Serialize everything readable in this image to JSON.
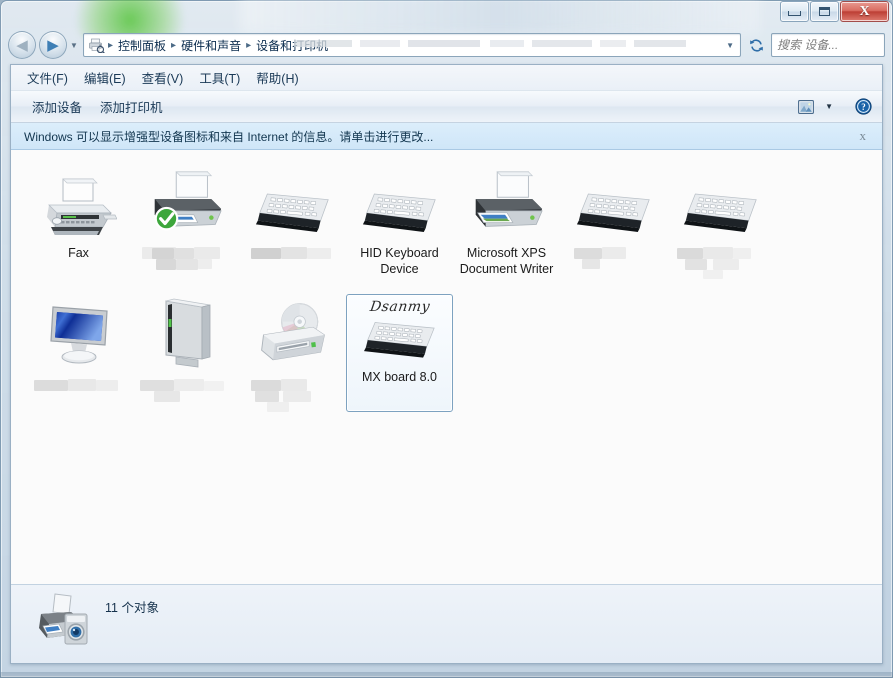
{
  "window": {
    "title": "设备和打印机",
    "buttons": {
      "minimize": "minimize-button",
      "maximize": "maximize-button",
      "close_glyph": "X"
    }
  },
  "navbar": {
    "back_tooltip": "后退",
    "forward_tooltip": "前进",
    "breadcrumb": [
      "控制面板",
      "硬件和声音",
      "设备和打印机"
    ],
    "breadcrumb_separator": "▶",
    "dropdown_glyph": "▼",
    "refresh_glyph": "↻",
    "search": {
      "placeholder": "搜索 设备...",
      "value": ""
    }
  },
  "menu": {
    "items": [
      "文件(F)",
      "编辑(E)",
      "查看(V)",
      "工具(T)",
      "帮助(H)"
    ]
  },
  "commandbar": {
    "items": [
      "添加设备",
      "添加打印机"
    ],
    "view_caret": "▼",
    "help_glyph": "?"
  },
  "notification": {
    "message": "Windows 可以显示增强型设备图标和来自 Internet 的信息。请单击进行更改...",
    "close_glyph": "x"
  },
  "devices": [
    {
      "label": "Fax",
      "icon": "fax-icon",
      "redacted": false,
      "selected": false,
      "default": false
    },
    {
      "label": "",
      "icon": "printer-icon",
      "redacted": true,
      "selected": false,
      "default": true
    },
    {
      "label": "",
      "icon": "keyboard-icon",
      "redacted": true,
      "selected": false,
      "default": false
    },
    {
      "label": "HID Keyboard Device",
      "icon": "keyboard-icon",
      "redacted": false,
      "selected": false,
      "default": false
    },
    {
      "label": "Microsoft XPS Document Writer",
      "icon": "xps-printer-icon",
      "redacted": false,
      "selected": false,
      "default": false
    },
    {
      "label": "",
      "icon": "keyboard-icon",
      "redacted": true,
      "selected": false,
      "default": false
    },
    {
      "label": "",
      "icon": "keyboard-icon",
      "redacted": true,
      "selected": false,
      "default": false
    },
    {
      "label": "",
      "icon": "monitor-icon",
      "redacted": true,
      "selected": false,
      "default": false
    },
    {
      "label": "",
      "icon": "harddisk-icon",
      "redacted": true,
      "selected": false,
      "default": false
    },
    {
      "label": "",
      "icon": "optical-drive-icon",
      "redacted": true,
      "selected": false,
      "default": false
    },
    {
      "label": "MX board 8.0",
      "icon": "keyboard-icon",
      "redacted": false,
      "selected": true,
      "default": false,
      "brand": "Dsanmy"
    }
  ],
  "statusbar": {
    "icon": "printer-scanner-icon",
    "text": "11 个对象"
  },
  "colors": {
    "accent": "#2f6ea8",
    "notification_bg": "#cfe6f8",
    "selection_border": "#7da2c0",
    "content_bg": "#fbfbfb",
    "close_button": "#bd3f35",
    "default_badge": "#2da63f"
  }
}
